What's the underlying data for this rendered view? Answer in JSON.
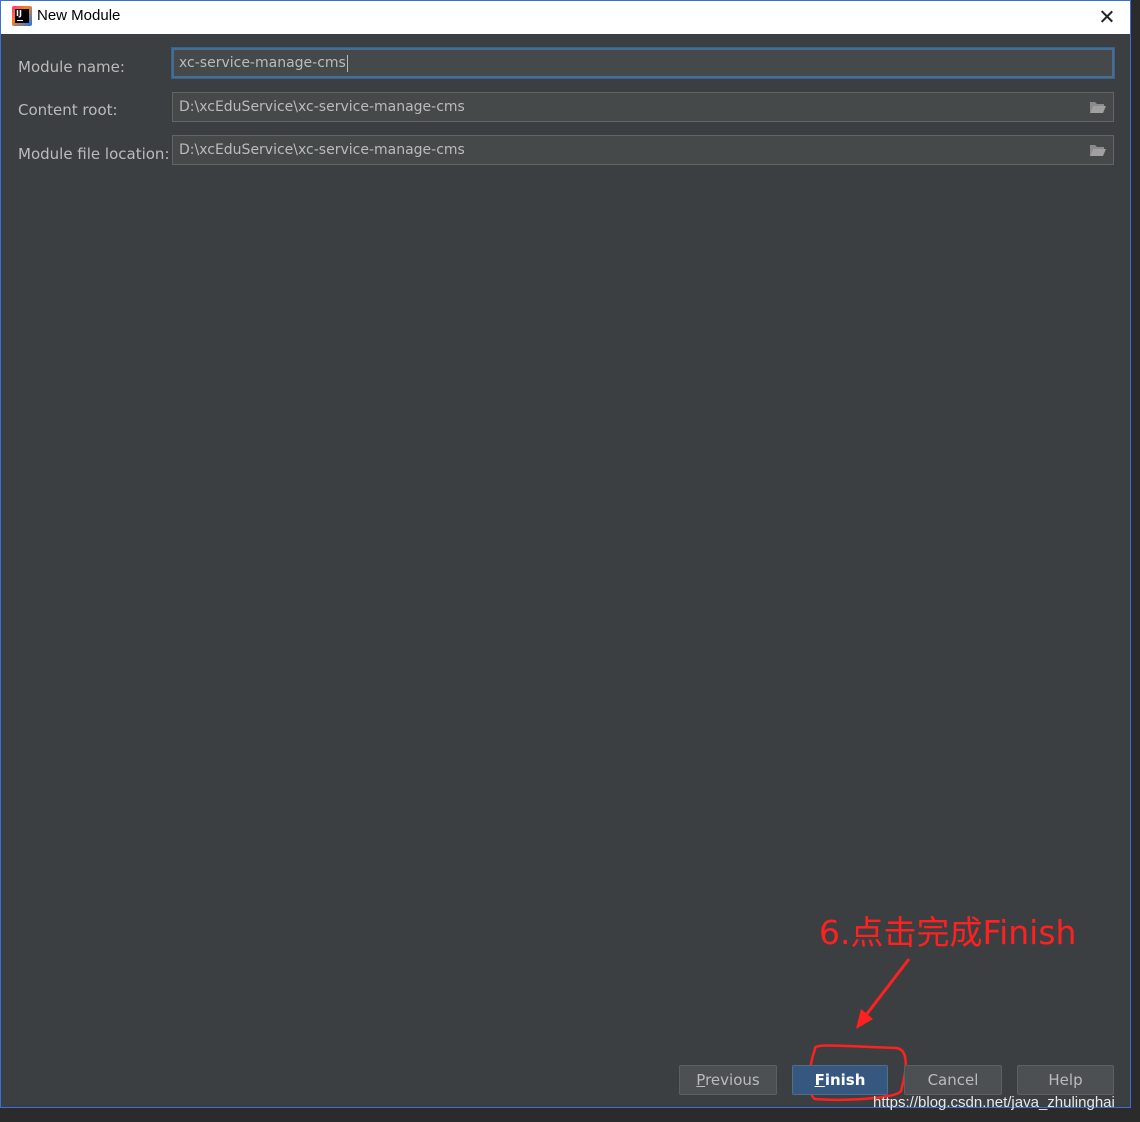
{
  "window": {
    "title": "New Module"
  },
  "form": {
    "module_name": {
      "label": "Module name:",
      "value": "xc-service-manage-cms"
    },
    "content_root": {
      "label": "Content root:",
      "value": "D:\\xcEduService\\xc-service-manage-cms"
    },
    "module_file_location": {
      "label": "Module file location:",
      "value": "D:\\xcEduService\\xc-service-manage-cms"
    }
  },
  "buttons": {
    "previous": {
      "mnemonic": "P",
      "rest": "revious"
    },
    "finish": {
      "mnemonic": "F",
      "rest": "inish"
    },
    "cancel": {
      "label": "Cancel"
    },
    "help": {
      "label": "Help"
    }
  },
  "annotation": {
    "text": "6.点击完成Finish",
    "color": "#ff2020"
  },
  "watermark": {
    "text": "https://blog.csdn.net/java_zhulinghai"
  },
  "icons": {
    "app": "intellij-idea-icon",
    "close": "close-icon",
    "folder": "folder-open-icon"
  }
}
